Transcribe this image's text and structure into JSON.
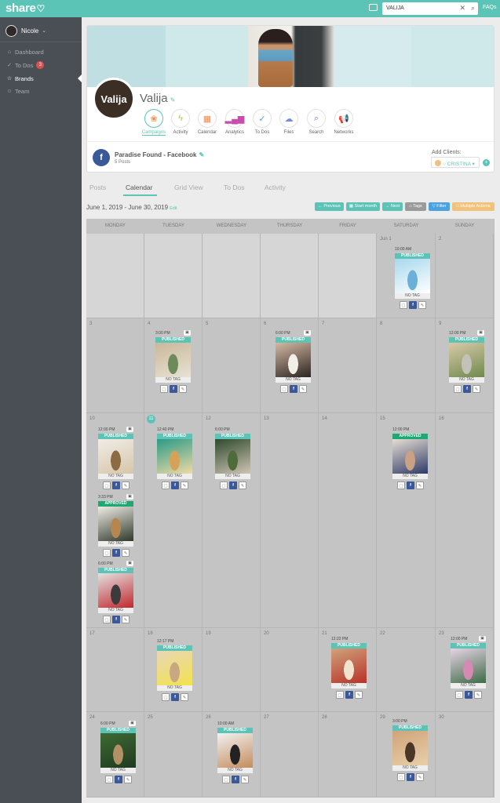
{
  "app": {
    "logo": "share",
    "search_value": "VALIJA",
    "faqs": "FAQs"
  },
  "sidebar": {
    "user_name": "Nicole",
    "items": [
      {
        "label": "Dashboard",
        "icon": "home-icon"
      },
      {
        "label": "To Dos",
        "icon": "check-icon",
        "badge": "3"
      },
      {
        "label": "Brands",
        "icon": "star-icon",
        "active": true
      },
      {
        "label": "Team",
        "icon": "team-icon"
      }
    ]
  },
  "brand": {
    "avatar_text": "Valija",
    "name": "Valija",
    "tools": [
      "Campaigns",
      "Activity",
      "Calendar",
      "Analytics",
      "To Dos",
      "Files",
      "Search",
      "Networks"
    ],
    "campaign_name": "Paradise Found - Facebook",
    "campaign_posts": "5 Posts",
    "add_clients_label": "Add Clients:",
    "client_name": "CRISTINA"
  },
  "tabs": [
    "Posts",
    "Calendar",
    "Grid View",
    "To Dos",
    "Activity"
  ],
  "range": {
    "label": "June 1, 2019 - June 30, 2019",
    "edit": "Edit"
  },
  "actions": [
    "Previous",
    "Start month",
    "Next",
    "Tags",
    "Filter",
    "Multiple Actions"
  ],
  "calendar": {
    "days": [
      "MONDAY",
      "TUESDAY",
      "WEDNESDAY",
      "THURSDAY",
      "FRIDAY",
      "SATURDAY",
      "SUNDAY"
    ],
    "tag_label": "NO TAG",
    "dates": [
      [
        "",
        "",
        "",
        "",
        "",
        "Jun 1",
        "2"
      ],
      [
        "3",
        "4",
        "5",
        "6",
        "7",
        "8",
        "9"
      ],
      [
        "10",
        "11",
        "12",
        "13",
        "14",
        "15",
        "16"
      ],
      [
        "17",
        "18",
        "19",
        "20",
        "21",
        "22",
        "23"
      ],
      [
        "24",
        "25",
        "26",
        "27",
        "28",
        "29",
        "30"
      ]
    ],
    "posts": [
      {
        "time": "10:00 AM",
        "status": "PUBLISHED",
        "camera": false,
        "palette": [
          "#a8d8ee",
          "#ffffff",
          "#6bb0d8"
        ]
      },
      {
        "time": "3:00 PM",
        "status": "PUBLISHED",
        "camera": true,
        "palette": [
          "#c9b79a",
          "#e8e2d3",
          "#6e8a5b"
        ]
      },
      {
        "time": "6:00 PM",
        "status": "PUBLISHED",
        "camera": true,
        "palette": [
          "#d5b9a2",
          "#2b2522",
          "#f2efe9"
        ]
      },
      {
        "time": "12:00 PM",
        "status": "PUBLISHED",
        "camera": true,
        "palette": [
          "#d9c9a8",
          "#6f8a4e",
          "#c3c1b8"
        ]
      },
      {
        "time": "12:00 PM",
        "status": "PUBLISHED",
        "camera": true,
        "palette": [
          "#f0ece6",
          "#d7c6a8",
          "#8b6a44"
        ]
      },
      {
        "time": "12:40 PM",
        "status": "PUBLISHED",
        "camera": false,
        "palette": [
          "#2c9a86",
          "#eedaa6",
          "#d6a257"
        ]
      },
      {
        "time": "6:00 PM",
        "status": "PUBLISHED",
        "camera": false,
        "palette": [
          "#2f4a2d",
          "#cfc4b3",
          "#4e6b3b"
        ]
      },
      {
        "time": "12:00 PM",
        "status": "APPROVED",
        "camera": false,
        "palette": [
          "#e6ded3",
          "#2f3a66",
          "#c9a184"
        ]
      },
      {
        "time": "3:33 PM",
        "status": "APPROVED",
        "camera": true,
        "palette": [
          "#f0ece6",
          "#2e3a2a",
          "#b7864f"
        ]
      },
      {
        "time": "6:00 PM",
        "status": "PUBLISHED",
        "camera": true,
        "palette": [
          "#e2e2e2",
          "#c2282e",
          "#3b3b3b"
        ]
      },
      {
        "time": "12:17 PM",
        "status": "PUBLISHED",
        "camera": false,
        "palette": [
          "#e8d7b7",
          "#f2e24d",
          "#c8a882"
        ]
      },
      {
        "time": "12:22 PM",
        "status": "PUBLISHED",
        "camera": false,
        "palette": [
          "#cfa27a",
          "#b8322a",
          "#f1e4cf"
        ]
      },
      {
        "time": "12:00 PM",
        "status": "PUBLISHED",
        "camera": true,
        "palette": [
          "#e8d3e5",
          "#3d6b47",
          "#d58ab3"
        ]
      },
      {
        "time": "6:00 PM",
        "status": "PUBLISHED",
        "camera": true,
        "palette": [
          "#3e6a35",
          "#1f3a1e",
          "#b39066"
        ]
      },
      {
        "time": "10:00 AM",
        "status": "PUBLISHED",
        "camera": false,
        "palette": [
          "#f1f1f1",
          "#c58c5c",
          "#222222"
        ]
      },
      {
        "time": "3:00 PM",
        "status": "PUBLISHED",
        "camera": false,
        "palette": [
          "#cfa47b",
          "#e8cfa9",
          "#4a3728"
        ]
      }
    ]
  },
  "colors": {
    "accent": "#5bc4b6",
    "published": "#5bc4b6",
    "approved": "#1fa774",
    "facebook": "#3b5998",
    "badge": "#e04f4f"
  }
}
